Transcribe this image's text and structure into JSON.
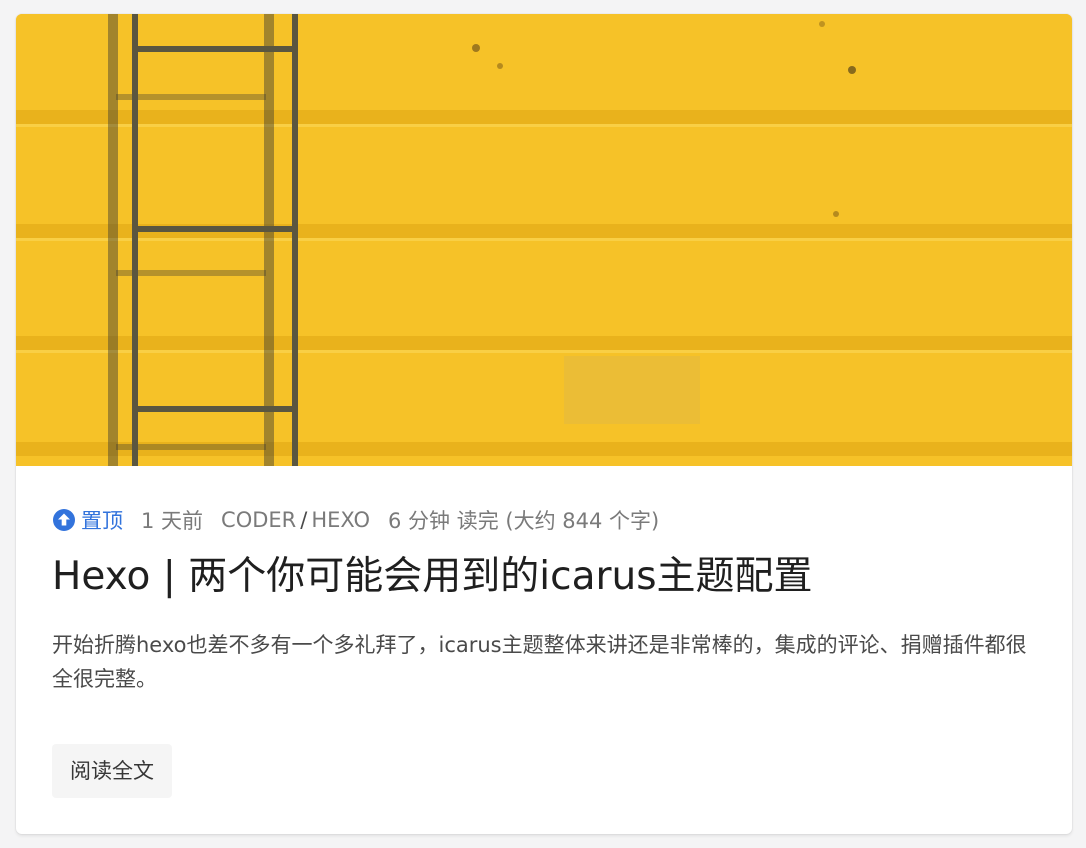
{
  "post": {
    "cover_icon": "cover-image-yellow-wall-with-ladder",
    "meta": {
      "pinned_icon": "arrow-up-circle-icon",
      "pinned_label": "置顶",
      "date": "1 天前",
      "category_1": "CODER",
      "category_separator": "/",
      "category_2": "HEXO",
      "read_time": "6 分钟 读完 (大约 844 个字)"
    },
    "title": "Hexo | 两个你可能会用到的icarus主题配置",
    "excerpt": "开始折腾hexo也差不多有一个多礼拜了，icarus主题整体来讲还是非常棒的，集成的评论、捐赠插件都很全很完整。",
    "read_more_label": "阅读全文"
  },
  "colors": {
    "accent": "#3273dc",
    "cover_yellow": "#f6c228",
    "title": "#1f1f1f",
    "meta": "#7a7a7a"
  }
}
